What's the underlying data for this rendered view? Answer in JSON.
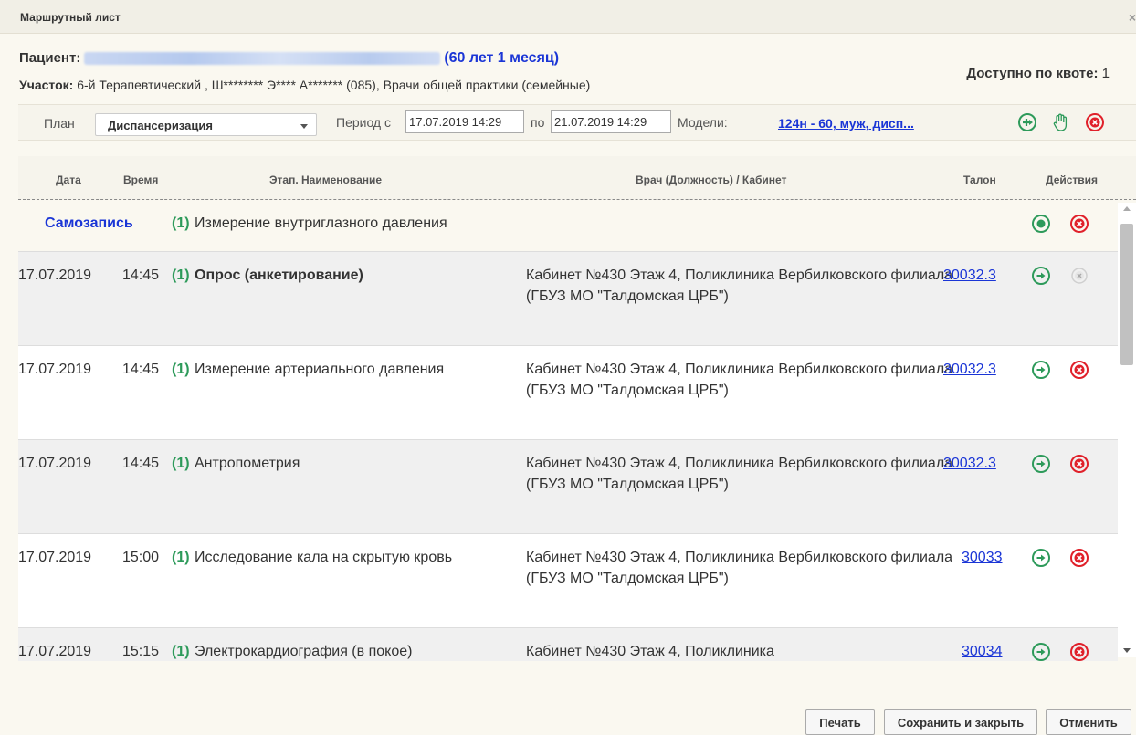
{
  "window": {
    "title": "Маршрутный лист",
    "close_glyph": "×"
  },
  "patient": {
    "label": "Пациент:",
    "age": "(60 лет 1 месяц)",
    "section_label": "Участок:",
    "section_value": "6-й Терапевтический , Ш******** Э**** А******* (085), Врачи общей практики (семейные)",
    "quota_label": "Доступно по квоте:",
    "quota_value": "1"
  },
  "filters": {
    "plan_label": "План",
    "plan_value": "Диспансеризация",
    "period_label": "Период с",
    "period_from": "17.07.2019 14:29",
    "period_to_label": "по",
    "period_to": "21.07.2019 14:29",
    "models_label": "Модели:",
    "models_link": "124н - 60, муж, дисп..."
  },
  "icons": {
    "add": "add-circle-icon",
    "hand": "hand-icon",
    "cancel": "cancel-circle-icon"
  },
  "colors": {
    "accent_blue": "#1a35d6",
    "green": "#2d9a5a",
    "red": "#e0202a"
  },
  "table": {
    "headers": {
      "date": "Дата",
      "time": "Время",
      "name": "Этап. Наименование",
      "doctor": "Врач (Должность) / Кабинет",
      "talon": "Талон",
      "actions": "Действия"
    },
    "selfrecord": {
      "label": "Самозапись",
      "num": "(1)",
      "name": "Измерение внутриглазного давления"
    },
    "rows": [
      {
        "date": "17.07.2019",
        "time": "14:45",
        "num": "(1)",
        "name": "Опрос (анкетирование)",
        "doctor": "Кабинет №430 Этаж 4, Поликлиника Вербилковского филиала (ГБУЗ МО \"Талдомская ЦРБ\")",
        "talon": "30032.3"
      },
      {
        "date": "17.07.2019",
        "time": "14:45",
        "num": "(1)",
        "name": "Измерение артериального давления",
        "doctor": "Кабинет №430 Этаж 4, Поликлиника Вербилковского филиала (ГБУЗ МО \"Талдомская ЦРБ\")",
        "talon": "30032.3"
      },
      {
        "date": "17.07.2019",
        "time": "14:45",
        "num": "(1)",
        "name": "Антропометрия",
        "doctor": "Кабинет №430 Этаж 4, Поликлиника Вербилковского филиала (ГБУЗ МО \"Талдомская ЦРБ\")",
        "talon": "30032.3"
      },
      {
        "date": "17.07.2019",
        "time": "15:00",
        "num": "(1)",
        "name": "Исследование кала на скрытую кровь",
        "doctor": "Кабинет №430 Этаж 4, Поликлиника Вербилковского филиала (ГБУЗ МО \"Талдомская ЦРБ\")",
        "talon": "30033"
      },
      {
        "date": "17.07.2019",
        "time": "15:15",
        "num": "(1)",
        "name": "Электрокардиография (в покое)",
        "doctor": "Кабинет №430 Этаж 4, Поликлиника",
        "talon": "30034"
      }
    ]
  },
  "footer": {
    "print": "Печать",
    "save_close": "Сохранить и закрыть",
    "cancel": "Отменить"
  }
}
